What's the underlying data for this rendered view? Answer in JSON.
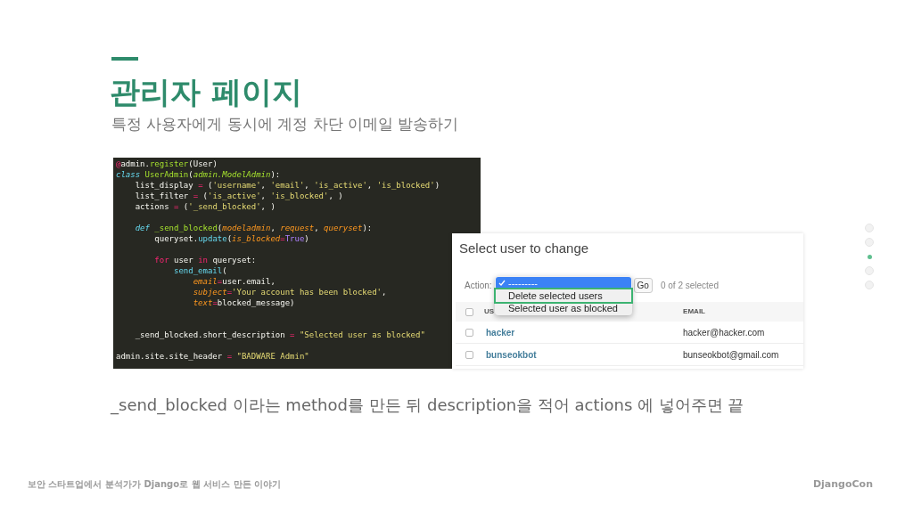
{
  "slide": {
    "title": "관리자 페이지",
    "subtitle": "특정 사용자에게 동시에 계정 차단 이메일 발송하기",
    "caption": "_send_blocked 이라는 method를 만든 뒤 description을 적어 actions 에 넣어주면 끝"
  },
  "code_lines": [
    {
      "kind": "code",
      "tokens": [
        {
          "t": "@",
          "kind": "op"
        },
        {
          "t": "admin.",
          "kind": "plain"
        },
        {
          "t": "register",
          "kind": "name"
        },
        {
          "t": "(User)",
          "kind": "plain"
        }
      ]
    },
    {
      "kind": "code",
      "tokens": [
        {
          "t": "class ",
          "kind": "kw"
        },
        {
          "t": "UserAdmin",
          "kind": "name"
        },
        {
          "t": "(",
          "kind": "plain"
        },
        {
          "t": "admin.ModelAdmin",
          "kind": "base"
        },
        {
          "t": "):",
          "kind": "plain"
        }
      ]
    },
    {
      "kind": "code",
      "tokens": [
        {
          "t": "    list_display ",
          "kind": "plain"
        },
        {
          "t": "=",
          "kind": "op"
        },
        {
          "t": " (",
          "kind": "plain"
        },
        {
          "t": "'username'",
          "kind": "str"
        },
        {
          "t": ", ",
          "kind": "plain"
        },
        {
          "t": "'email'",
          "kind": "str"
        },
        {
          "t": ", ",
          "kind": "plain"
        },
        {
          "t": "'is_active'",
          "kind": "str"
        },
        {
          "t": ", ",
          "kind": "plain"
        },
        {
          "t": "'is_blocked'",
          "kind": "str"
        },
        {
          "t": ")",
          "kind": "plain"
        }
      ]
    },
    {
      "kind": "code",
      "tokens": [
        {
          "t": "    list_filter ",
          "kind": "plain"
        },
        {
          "t": "=",
          "kind": "op"
        },
        {
          "t": " (",
          "kind": "plain"
        },
        {
          "t": "'is_active'",
          "kind": "str"
        },
        {
          "t": ", ",
          "kind": "plain"
        },
        {
          "t": "'is_blocked'",
          "kind": "str"
        },
        {
          "t": ", )",
          "kind": "plain"
        }
      ]
    },
    {
      "kind": "code",
      "tokens": [
        {
          "t": "    actions ",
          "kind": "plain"
        },
        {
          "t": "=",
          "kind": "op"
        },
        {
          "t": " (",
          "kind": "plain"
        },
        {
          "t": "'_send_blocked'",
          "kind": "str"
        },
        {
          "t": ", )",
          "kind": "plain"
        }
      ]
    },
    {
      "kind": "blank"
    },
    {
      "kind": "code",
      "tokens": [
        {
          "t": "    def ",
          "kind": "kw"
        },
        {
          "t": "_send_blocked",
          "kind": "name"
        },
        {
          "t": "(",
          "kind": "plain"
        },
        {
          "t": "modeladmin",
          "kind": "param"
        },
        {
          "t": ", ",
          "kind": "plain"
        },
        {
          "t": "request",
          "kind": "param"
        },
        {
          "t": ", ",
          "kind": "plain"
        },
        {
          "t": "queryset",
          "kind": "param"
        },
        {
          "t": "):",
          "kind": "plain"
        }
      ]
    },
    {
      "kind": "code",
      "tokens": [
        {
          "t": "        queryset.",
          "kind": "plain"
        },
        {
          "t": "update",
          "kind": "call"
        },
        {
          "t": "(",
          "kind": "plain"
        },
        {
          "t": "is_blocked",
          "kind": "param"
        },
        {
          "t": "=",
          "kind": "op"
        },
        {
          "t": "True",
          "kind": "const"
        },
        {
          "t": ")",
          "kind": "plain"
        }
      ]
    },
    {
      "kind": "blank"
    },
    {
      "kind": "code",
      "tokens": [
        {
          "t": "        for",
          "kind": "ctrl"
        },
        {
          "t": " user ",
          "kind": "plain"
        },
        {
          "t": "in",
          "kind": "ctrl"
        },
        {
          "t": " queryset:",
          "kind": "plain"
        }
      ]
    },
    {
      "kind": "code",
      "tokens": [
        {
          "t": "            send_email",
          "kind": "call"
        },
        {
          "t": "(",
          "kind": "plain"
        }
      ]
    },
    {
      "kind": "code",
      "tokens": [
        {
          "t": "                email",
          "kind": "param"
        },
        {
          "t": "=",
          "kind": "op"
        },
        {
          "t": "user.email,",
          "kind": "plain"
        }
      ]
    },
    {
      "kind": "code",
      "tokens": [
        {
          "t": "                subject",
          "kind": "param"
        },
        {
          "t": "=",
          "kind": "op"
        },
        {
          "t": "'Your account has been blocked'",
          "kind": "str"
        },
        {
          "t": ",",
          "kind": "plain"
        }
      ]
    },
    {
      "kind": "code",
      "tokens": [
        {
          "t": "                text",
          "kind": "param"
        },
        {
          "t": "=",
          "kind": "op"
        },
        {
          "t": "blocked_message)",
          "kind": "plain"
        }
      ]
    },
    {
      "kind": "blank"
    },
    {
      "kind": "blank"
    },
    {
      "kind": "code",
      "tokens": [
        {
          "t": "    _send_blocked.short_description ",
          "kind": "plain"
        },
        {
          "t": "= ",
          "kind": "op"
        },
        {
          "t": "\"Selected user as blocked\"",
          "kind": "str"
        }
      ]
    },
    {
      "kind": "blank"
    },
    {
      "kind": "code",
      "tokens": [
        {
          "t": "admin.site.site_header ",
          "kind": "plain"
        },
        {
          "t": "= ",
          "kind": "op"
        },
        {
          "t": "\"BADWARE Admin\"",
          "kind": "str"
        }
      ]
    }
  ],
  "admin": {
    "title": "Select user to change",
    "action_label": "Action:",
    "go_button": "Go",
    "selection_count": "0 of 2 selected",
    "action_options": [
      {
        "label": "---------",
        "selected": true,
        "highlighted": false
      },
      {
        "label": "Delete selected users",
        "selected": false,
        "highlighted": true
      },
      {
        "label": "Selected user as blocked",
        "selected": false,
        "highlighted": false
      }
    ],
    "table": {
      "select_all_checked": false,
      "columns": [
        "US",
        "EMAIL"
      ],
      "rows": [
        {
          "checked": false,
          "cells": [
            "hacker",
            "hacker@hacker.com"
          ]
        },
        {
          "checked": false,
          "cells": [
            "bunseokbot",
            "bunseokbot@gmail.com"
          ]
        }
      ]
    }
  },
  "nav_dots": [
    {
      "selected": false
    },
    {
      "selected": false
    },
    {
      "selected": true
    },
    {
      "selected": false
    },
    {
      "selected": false
    }
  ],
  "footer": {
    "left": "보안 스타트업에서 분석가가 Django로 웹 서비스 만든 이야기",
    "right": "DjangoCon"
  }
}
